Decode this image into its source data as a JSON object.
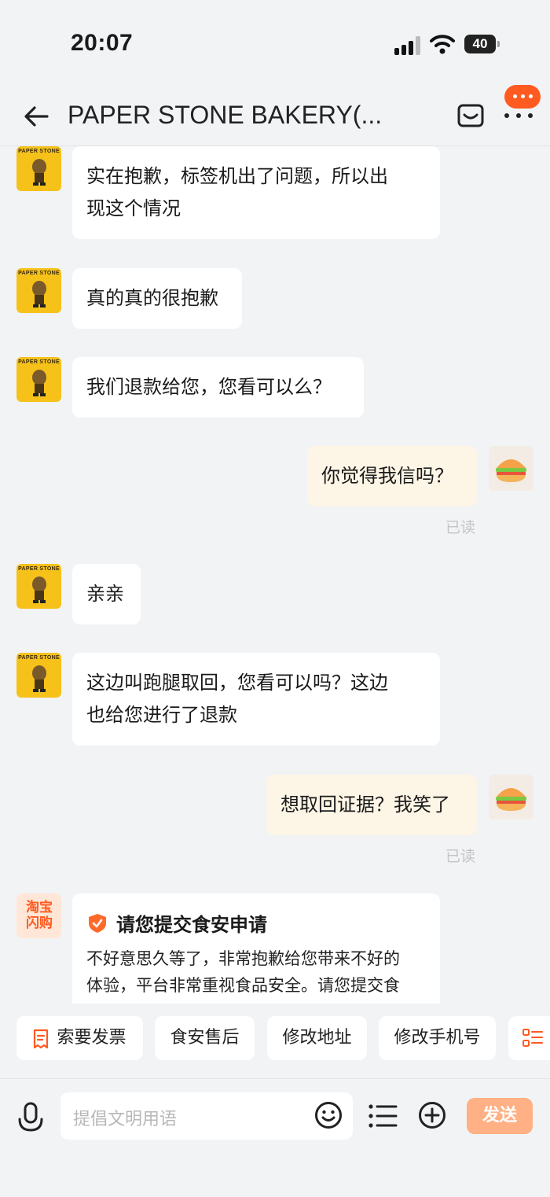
{
  "status_bar": {
    "time": "20:07",
    "battery": "40"
  },
  "header": {
    "title": "PAPER STONE BAKERY(..."
  },
  "shop_logo_text": "PAPER STONE",
  "messages": [
    {
      "side": "in",
      "lines": [
        "实在抱歉，标签机出了问题，所以出",
        "现这个情况"
      ]
    },
    {
      "side": "in",
      "lines": [
        "真的真的很抱歉"
      ]
    },
    {
      "side": "in",
      "lines": [
        "我们退款给您，您看可以么？"
      ]
    },
    {
      "side": "out",
      "lines": [
        "你觉得我信吗？"
      ],
      "status": "已读"
    },
    {
      "side": "in",
      "lines": [
        "亲亲"
      ]
    },
    {
      "side": "in",
      "lines": [
        "这边叫跑腿取回，您看可以吗？这边",
        "也给您进行了退款"
      ]
    },
    {
      "side": "out",
      "lines": [
        "想取回证据？我笑了"
      ],
      "status": "已读"
    }
  ],
  "system_card": {
    "avatar_lines": [
      "淘宝",
      "闪购"
    ],
    "title": "请您提交食安申请",
    "body_lines": [
      "不好意思久等了，非常抱歉给您带来不好的",
      "体验，平台非常重视食品安全。请您提交食"
    ]
  },
  "quick_actions": [
    "索要发票",
    "食安售后",
    "修改地址",
    "修改手机号"
  ],
  "input": {
    "placeholder": "提倡文明用语",
    "send_label": "发送"
  },
  "colors": {
    "accent": "#ff5a1f",
    "send_button": "#ffb084",
    "out_bubble": "#fdf5e6",
    "shop_avatar": "#f6c21a"
  }
}
